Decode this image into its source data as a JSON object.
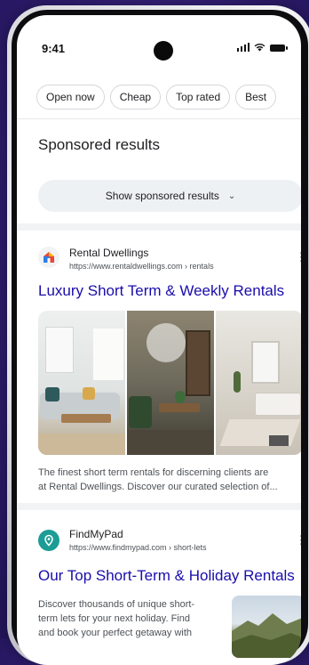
{
  "status_bar": {
    "time": "9:41"
  },
  "chips": [
    "Open now",
    "Cheap",
    "Top rated",
    "Best"
  ],
  "sponsored": {
    "title": "Sponsored results",
    "show_button": "Show sponsored results"
  },
  "results": [
    {
      "site_name": "Rental Dwellings",
      "url": "https://www.rentaldwellings.com › rentals",
      "title": "Luxury Short Term & Weekly Rentals",
      "snippet_lines": [
        "The finest short term rentals for discerning clients are",
        "at Rental Dwellings. Discover our curated selection of..."
      ],
      "images": [
        "living-room-photo",
        "lounge-with-bookshelf-photo",
        "bedroom-photo"
      ]
    },
    {
      "site_name": "FindMyPad",
      "url": "https://www.findmypad.com › short-lets",
      "title": "Our Top Short-Term & Holiday Rentals",
      "snippet_lines": [
        "Discover thousands of unique short-",
        "term lets for your next holiday. Find",
        "and book your perfect getaway with"
      ],
      "thumbnail": "mountain-landscape-photo"
    }
  ],
  "colors": {
    "link_blue": "#1a0dab",
    "background_purple": "#35207a",
    "findmypad_teal": "#1b9c94"
  }
}
